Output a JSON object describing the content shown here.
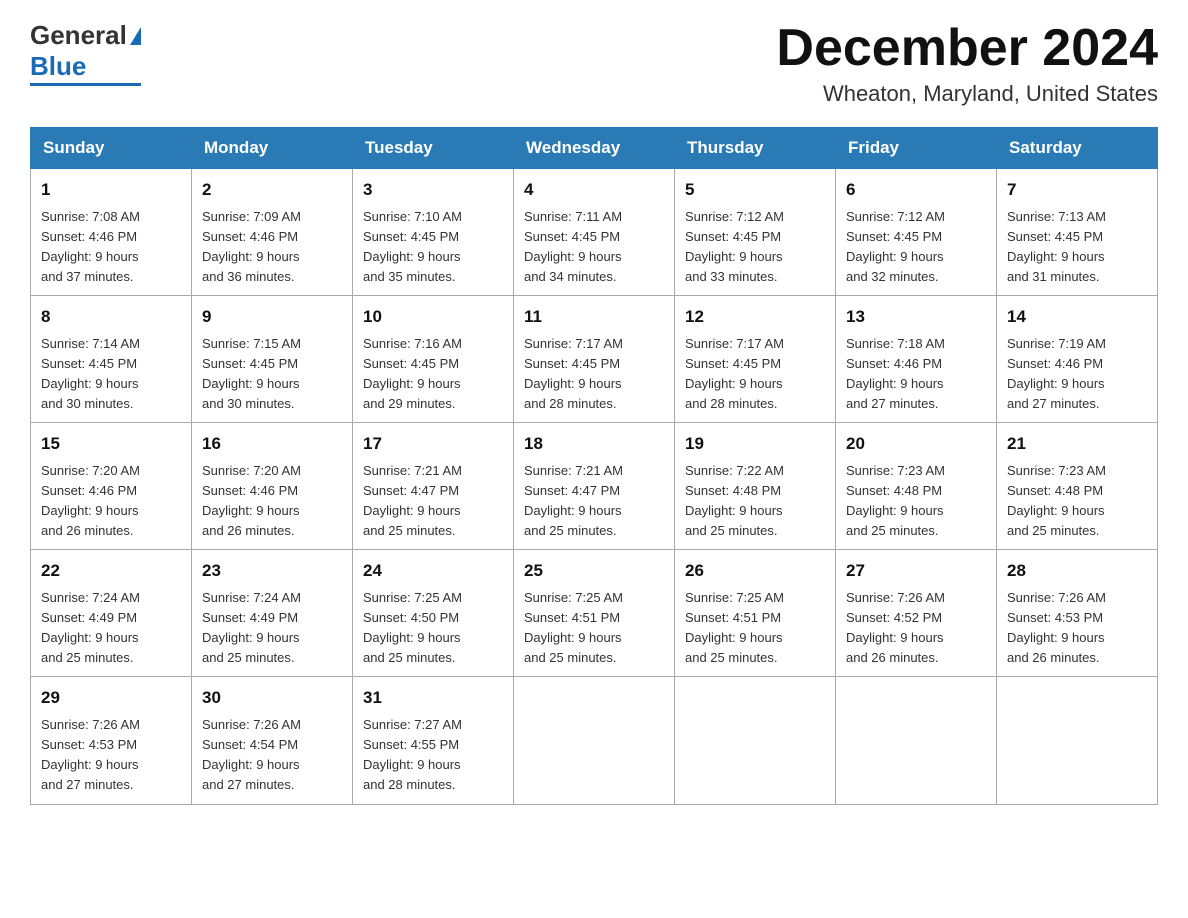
{
  "header": {
    "logo_general": "General",
    "logo_blue": "Blue",
    "month_title": "December 2024",
    "location": "Wheaton, Maryland, United States"
  },
  "weekdays": [
    "Sunday",
    "Monday",
    "Tuesday",
    "Wednesday",
    "Thursday",
    "Friday",
    "Saturday"
  ],
  "weeks": [
    [
      {
        "day": "1",
        "sunrise": "7:08 AM",
        "sunset": "4:46 PM",
        "daylight": "9 hours and 37 minutes."
      },
      {
        "day": "2",
        "sunrise": "7:09 AM",
        "sunset": "4:46 PM",
        "daylight": "9 hours and 36 minutes."
      },
      {
        "day": "3",
        "sunrise": "7:10 AM",
        "sunset": "4:45 PM",
        "daylight": "9 hours and 35 minutes."
      },
      {
        "day": "4",
        "sunrise": "7:11 AM",
        "sunset": "4:45 PM",
        "daylight": "9 hours and 34 minutes."
      },
      {
        "day": "5",
        "sunrise": "7:12 AM",
        "sunset": "4:45 PM",
        "daylight": "9 hours and 33 minutes."
      },
      {
        "day": "6",
        "sunrise": "7:12 AM",
        "sunset": "4:45 PM",
        "daylight": "9 hours and 32 minutes."
      },
      {
        "day": "7",
        "sunrise": "7:13 AM",
        "sunset": "4:45 PM",
        "daylight": "9 hours and 31 minutes."
      }
    ],
    [
      {
        "day": "8",
        "sunrise": "7:14 AM",
        "sunset": "4:45 PM",
        "daylight": "9 hours and 30 minutes."
      },
      {
        "day": "9",
        "sunrise": "7:15 AM",
        "sunset": "4:45 PM",
        "daylight": "9 hours and 30 minutes."
      },
      {
        "day": "10",
        "sunrise": "7:16 AM",
        "sunset": "4:45 PM",
        "daylight": "9 hours and 29 minutes."
      },
      {
        "day": "11",
        "sunrise": "7:17 AM",
        "sunset": "4:45 PM",
        "daylight": "9 hours and 28 minutes."
      },
      {
        "day": "12",
        "sunrise": "7:17 AM",
        "sunset": "4:45 PM",
        "daylight": "9 hours and 28 minutes."
      },
      {
        "day": "13",
        "sunrise": "7:18 AM",
        "sunset": "4:46 PM",
        "daylight": "9 hours and 27 minutes."
      },
      {
        "day": "14",
        "sunrise": "7:19 AM",
        "sunset": "4:46 PM",
        "daylight": "9 hours and 27 minutes."
      }
    ],
    [
      {
        "day": "15",
        "sunrise": "7:20 AM",
        "sunset": "4:46 PM",
        "daylight": "9 hours and 26 minutes."
      },
      {
        "day": "16",
        "sunrise": "7:20 AM",
        "sunset": "4:46 PM",
        "daylight": "9 hours and 26 minutes."
      },
      {
        "day": "17",
        "sunrise": "7:21 AM",
        "sunset": "4:47 PM",
        "daylight": "9 hours and 25 minutes."
      },
      {
        "day": "18",
        "sunrise": "7:21 AM",
        "sunset": "4:47 PM",
        "daylight": "9 hours and 25 minutes."
      },
      {
        "day": "19",
        "sunrise": "7:22 AM",
        "sunset": "4:48 PM",
        "daylight": "9 hours and 25 minutes."
      },
      {
        "day": "20",
        "sunrise": "7:23 AM",
        "sunset": "4:48 PM",
        "daylight": "9 hours and 25 minutes."
      },
      {
        "day": "21",
        "sunrise": "7:23 AM",
        "sunset": "4:48 PM",
        "daylight": "9 hours and 25 minutes."
      }
    ],
    [
      {
        "day": "22",
        "sunrise": "7:24 AM",
        "sunset": "4:49 PM",
        "daylight": "9 hours and 25 minutes."
      },
      {
        "day": "23",
        "sunrise": "7:24 AM",
        "sunset": "4:49 PM",
        "daylight": "9 hours and 25 minutes."
      },
      {
        "day": "24",
        "sunrise": "7:25 AM",
        "sunset": "4:50 PM",
        "daylight": "9 hours and 25 minutes."
      },
      {
        "day": "25",
        "sunrise": "7:25 AM",
        "sunset": "4:51 PM",
        "daylight": "9 hours and 25 minutes."
      },
      {
        "day": "26",
        "sunrise": "7:25 AM",
        "sunset": "4:51 PM",
        "daylight": "9 hours and 25 minutes."
      },
      {
        "day": "27",
        "sunrise": "7:26 AM",
        "sunset": "4:52 PM",
        "daylight": "9 hours and 26 minutes."
      },
      {
        "day": "28",
        "sunrise": "7:26 AM",
        "sunset": "4:53 PM",
        "daylight": "9 hours and 26 minutes."
      }
    ],
    [
      {
        "day": "29",
        "sunrise": "7:26 AM",
        "sunset": "4:53 PM",
        "daylight": "9 hours and 27 minutes."
      },
      {
        "day": "30",
        "sunrise": "7:26 AM",
        "sunset": "4:54 PM",
        "daylight": "9 hours and 27 minutes."
      },
      {
        "day": "31",
        "sunrise": "7:27 AM",
        "sunset": "4:55 PM",
        "daylight": "9 hours and 28 minutes."
      },
      null,
      null,
      null,
      null
    ]
  ],
  "labels": {
    "sunrise": "Sunrise:",
    "sunset": "Sunset:",
    "daylight": "Daylight:"
  }
}
